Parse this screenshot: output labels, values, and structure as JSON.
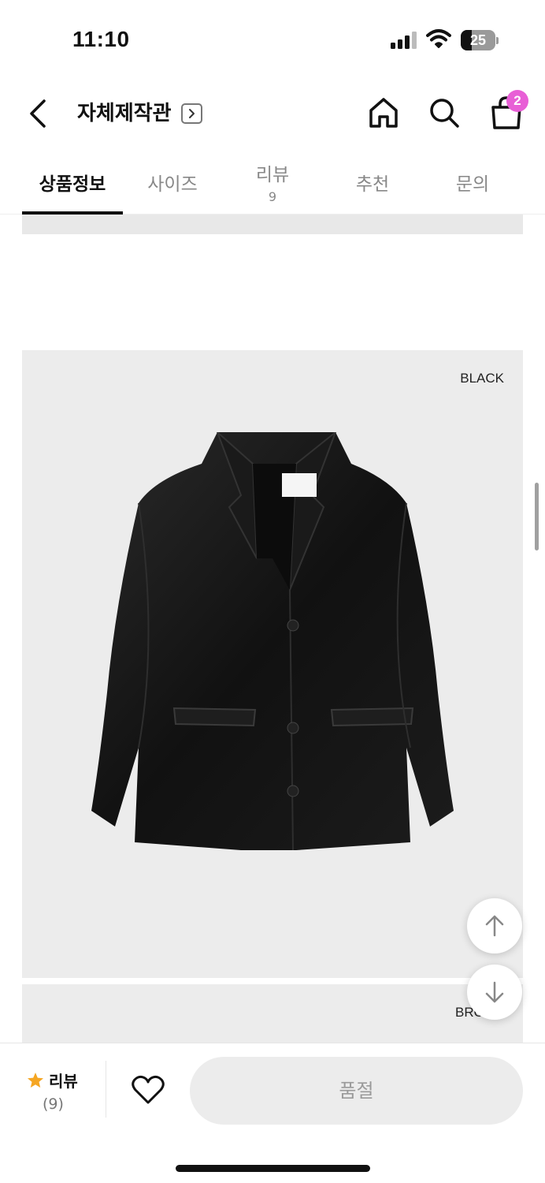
{
  "status_bar": {
    "time": "11:10",
    "battery": "25"
  },
  "header": {
    "title": "자체제작관",
    "cart_count": "2"
  },
  "tabs": [
    {
      "label": "상품정보",
      "active": true
    },
    {
      "label": "사이즈"
    },
    {
      "label": "리뷰",
      "count": "9"
    },
    {
      "label": "추천"
    },
    {
      "label": "문의"
    }
  ],
  "content": {
    "images": [
      {
        "color": "BLACK",
        "icon": "black-leather-jacket"
      },
      {
        "color": "BRO",
        "icon": "next-image-partial"
      }
    ]
  },
  "bottom_bar": {
    "review_label": "리뷰",
    "review_count": "(9)",
    "buy_button": "품절"
  },
  "colors": {
    "accent_badge": "#e85fd6",
    "star": "#f5a623",
    "image_bg": "#ececec"
  }
}
